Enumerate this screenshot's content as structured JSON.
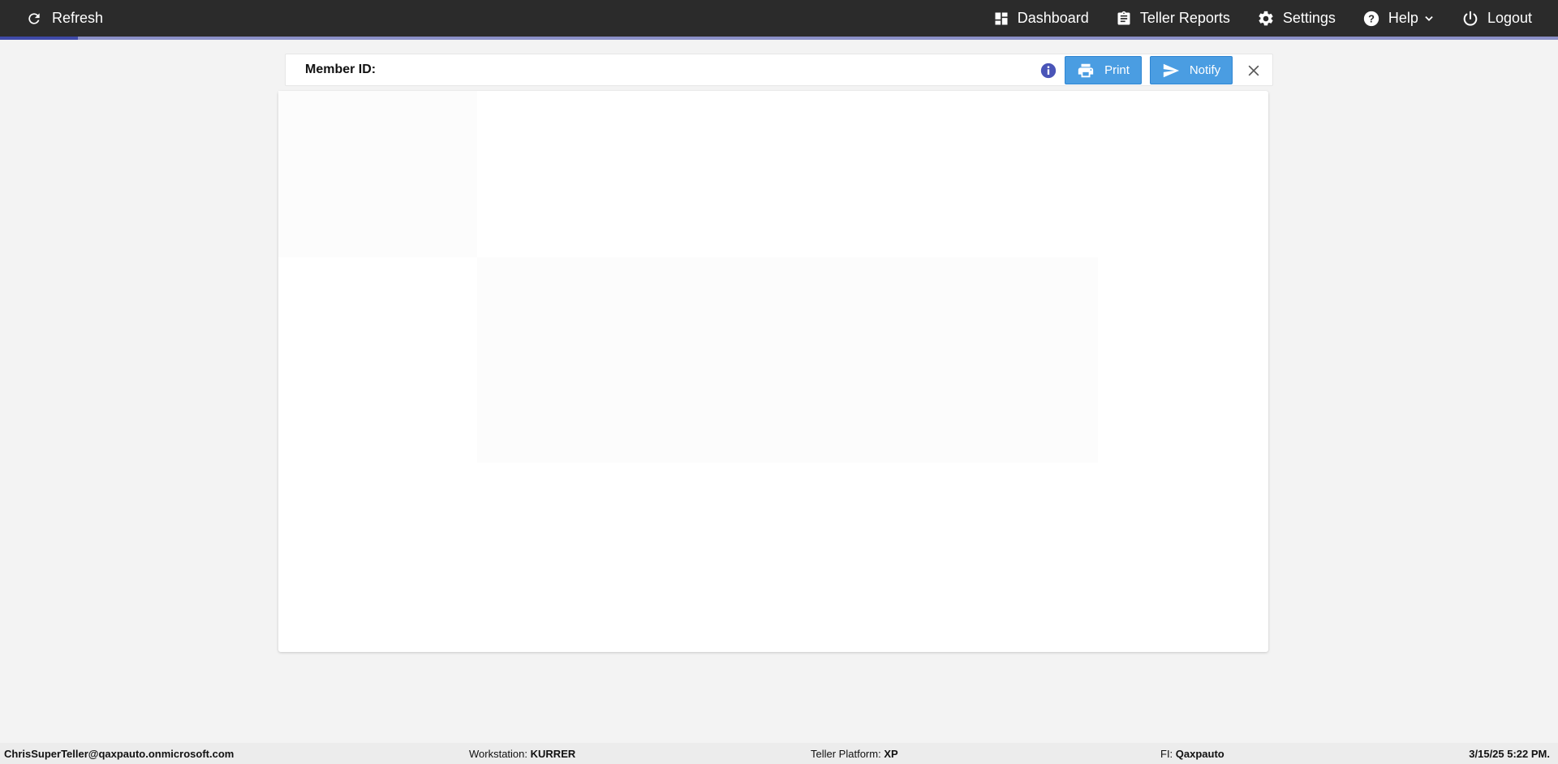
{
  "topbar": {
    "refresh_label": "Refresh",
    "nav": [
      {
        "label": "Dashboard",
        "icon": "dashboard-icon"
      },
      {
        "label": "Teller Reports",
        "icon": "clipboard-icon"
      },
      {
        "label": "Settings",
        "icon": "gear-icon"
      },
      {
        "label": "Help",
        "icon": "help-icon",
        "has_dropdown": true
      },
      {
        "label": "Logout",
        "icon": "power-icon"
      }
    ],
    "progress_fraction": 0.05
  },
  "member_bar": {
    "label": "Member ID:",
    "value": "",
    "print_label": "Print",
    "notify_label": "Notify"
  },
  "status_bar": {
    "user": "ChrisSuperTeller@qaxpauto.onmicrosoft.com",
    "workstation_label": "Workstation:",
    "workstation_value": "KURRER",
    "platform_label": "Teller Platform:",
    "platform_value": "XP",
    "fi_label": "FI:",
    "fi_value": "Qaxpauto",
    "datetime": "3/15/25 5:22 PM."
  },
  "colors": {
    "topbar": "#2b2b2b",
    "progress": "#3f4aa8",
    "button": "#4a9de2",
    "info_icon": "#4a55b8",
    "background": "#f3f3f3"
  }
}
